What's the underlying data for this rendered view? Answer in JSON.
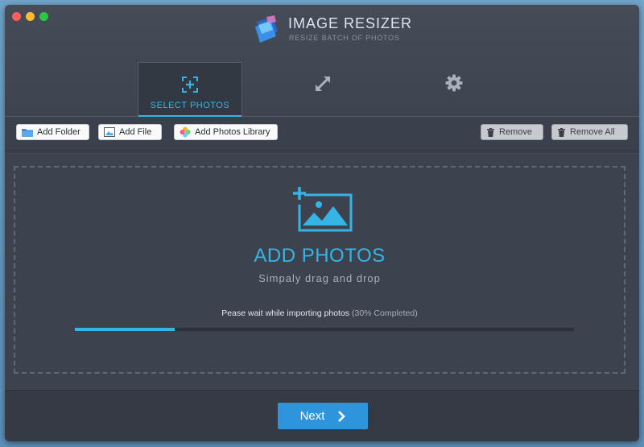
{
  "window": {
    "traffic_lights": [
      "close",
      "minimize",
      "zoom"
    ]
  },
  "app": {
    "title": "IMAGE RESIZER",
    "subtitle": "RESIZE BATCH OF PHOTOS",
    "logo_icon": "app-logo-icon"
  },
  "tabs": [
    {
      "label": "SELECT PHOTOS",
      "icon": "add-photo-icon",
      "active": true
    },
    {
      "label": "",
      "icon": "resize-arrows-icon",
      "active": false
    },
    {
      "label": "",
      "icon": "gear-icon",
      "active": false
    }
  ],
  "toolbar": {
    "add_folder": "Add Folder",
    "add_file": "Add File",
    "add_photos_library": "Add Photos Library",
    "remove": "Remove",
    "remove_all": "Remove All"
  },
  "dropzone": {
    "title": "ADD PHOTOS",
    "subtitle": "Simpaly drag and drop",
    "progress_text": "Pease wait while importing photos",
    "progress_pct_text": "(30% Completed)",
    "progress_fraction": 0.2
  },
  "footer": {
    "next_label": "Next"
  },
  "colors": {
    "accent": "#35b5e5",
    "next_button": "#2e95dc",
    "background": "#3d434e"
  }
}
